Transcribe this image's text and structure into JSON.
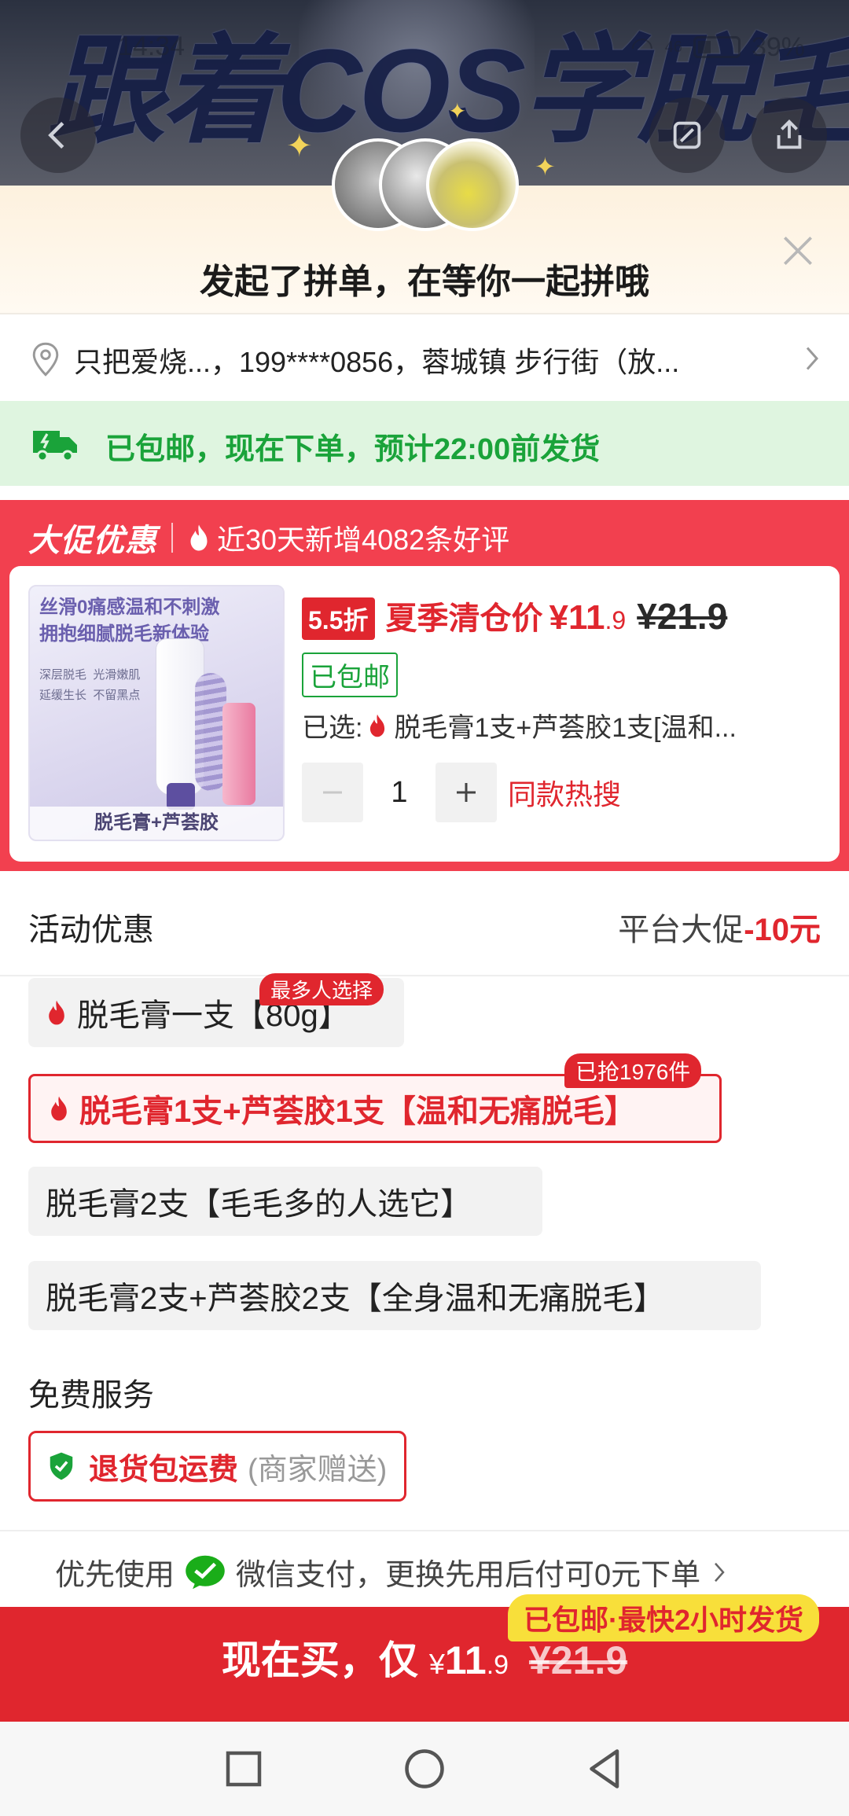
{
  "status_bar": {
    "time": "14:34",
    "signal": "46",
    "battery": "39%"
  },
  "banner": {
    "title": "跟着COS学脱毛"
  },
  "sheet": {
    "title": "发起了拼单，在等你一起拼哦",
    "address": "只把爱烧...，199****0856，蓉城镇 步行街（放...",
    "shipping_notice": "已包邮，现在下单，预计22:00前发货"
  },
  "promo": {
    "tag": "大促优惠",
    "reviews": "近30天新增4082条好评"
  },
  "product": {
    "thumb_headline_1": "丝滑0痛感温和不刺激",
    "thumb_headline_2": "拥抱细腻脱毛新体验",
    "thumb_features": [
      "深层脱毛",
      "光滑嫩肌",
      "延缓生长",
      "不留黑点"
    ],
    "thumb_caption": "脱毛膏+芦荟胶",
    "discount": "5.5折",
    "price_label": "夏季清仓价",
    "currency": "¥",
    "price_int": "11",
    "price_dec": ".9",
    "price_old": "¥21.9",
    "free_shipping": "已包邮",
    "selected_prefix": "已选:",
    "selected_value": "脱毛膏1支+芦荟胶1支[温和...",
    "quantity": "1",
    "same_search": "同款热搜"
  },
  "activity": {
    "label": "活动优惠",
    "right_label": "平台大促",
    "right_value": "-10元"
  },
  "options": [
    {
      "label": "脱毛膏一支【80g】",
      "badge": "最多人选择",
      "selected": false
    },
    {
      "label": "脱毛膏1支+芦荟胶1支【温和无痛脱毛】",
      "badge": "已抢1976件",
      "selected": true
    },
    {
      "label": "脱毛膏2支【毛毛多的人选它】",
      "badge": "",
      "selected": false
    },
    {
      "label": "脱毛膏2支+芦荟胶2支【全身温和无痛脱毛】",
      "badge": "",
      "selected": false
    }
  ],
  "services": {
    "label": "免费服务",
    "item_main": "退货包运费",
    "item_sub": "(商家赠送)"
  },
  "payment": {
    "prefix": "优先使用",
    "text": "微信支付，更换先用后付可0元下单"
  },
  "buy": {
    "tag": "已包邮·最快2小时发货",
    "label": "现在买，仅",
    "currency": "¥",
    "price_int": "11",
    "price_dec": ".9",
    "price_old": "¥21.9"
  },
  "colors": {
    "accent": "#e0262e",
    "promo_bg": "#f2404f",
    "green": "#1aa33a",
    "yellow_tag": "#f8df3a"
  }
}
